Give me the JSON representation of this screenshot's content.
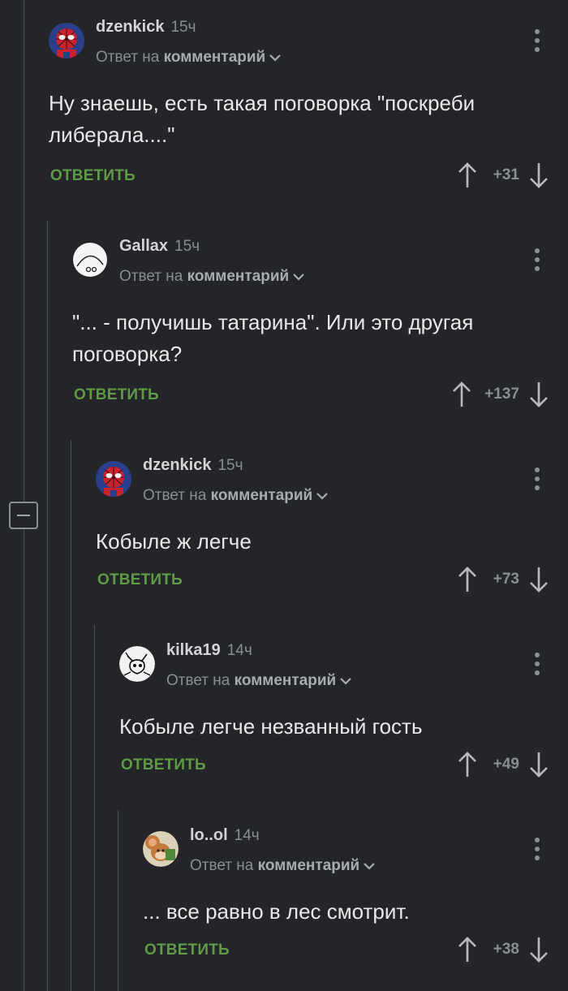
{
  "comments": [
    {
      "user": "dzenkick",
      "time": "15ч",
      "reply_prefix": "Ответ на",
      "reply_link": "комментарий",
      "text": "Ну знаешь, есть такая поговорка \"поскреби либерала....\"",
      "reply_label": "ОТВЕТИТЬ",
      "score": "+31",
      "avatar": "spiderman-avatar"
    },
    {
      "user": "Gallax",
      "time": "15ч",
      "reply_prefix": "Ответ на",
      "reply_link": "комментарий",
      "text": "\"... - получишь татарина\". Или это другая поговорка?",
      "reply_label": "ОТВЕТИТЬ",
      "score": "+137",
      "avatar": "cartoon-face-avatar"
    },
    {
      "user": "dzenkick",
      "time": "15ч",
      "reply_prefix": "Ответ на",
      "reply_link": "комментарий",
      "text": "Кобыле ж легче",
      "reply_label": "ОТВЕТИТЬ",
      "score": "+73",
      "avatar": "spiderman-avatar"
    },
    {
      "user": "kilka19",
      "time": "14ч",
      "reply_prefix": "Ответ на",
      "reply_link": "комментарий",
      "text": "Кобыле легче незванный гость",
      "reply_label": "ОТВЕТИТЬ",
      "score": "+49",
      "avatar": "sketch-cat-avatar"
    },
    {
      "user": "lo..ol",
      "time": "14ч",
      "reply_prefix": "Ответ на",
      "reply_link": "комментарий",
      "text": "... все равно в лес смотрит.",
      "reply_label": "ОТВЕТИТЬ",
      "score": "+38",
      "avatar": "cartoon-mouse-avatar"
    }
  ],
  "colors": {
    "background": "#232528",
    "reply_green": "#5f9a46",
    "muted": "#8a8d91",
    "thread_line": "#4a4d52"
  }
}
